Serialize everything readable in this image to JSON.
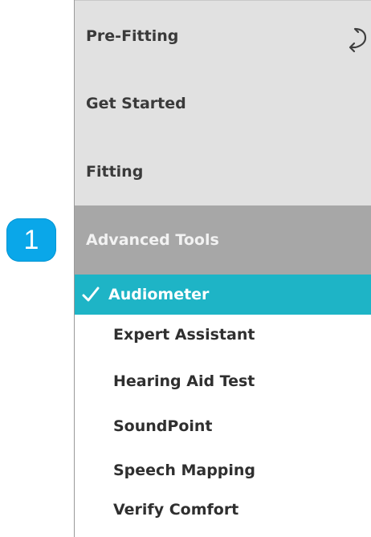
{
  "sections": {
    "pre_fitting": "Pre-Fitting",
    "get_started": "Get Started",
    "fitting": "Fitting",
    "advanced_tools": "Advanced Tools"
  },
  "badge": {
    "number": "1",
    "color": "#0aa7e9"
  },
  "advanced_items": [
    {
      "label": "Audiometer",
      "selected": true
    },
    {
      "label": "Expert Assistant",
      "selected": false
    },
    {
      "label": "Hearing Aid Test",
      "selected": false
    },
    {
      "label": "SoundPoint",
      "selected": false
    },
    {
      "label": "Speech Mapping",
      "selected": false
    },
    {
      "label": "Verify Comfort",
      "selected": false
    }
  ],
  "colors": {
    "selected_bg": "#1eb4c6",
    "advanced_bg": "#a7a7a7",
    "top_bg": "#e1e1e1"
  },
  "icons": {
    "sync": "sync-icon",
    "check": "check-icon"
  }
}
